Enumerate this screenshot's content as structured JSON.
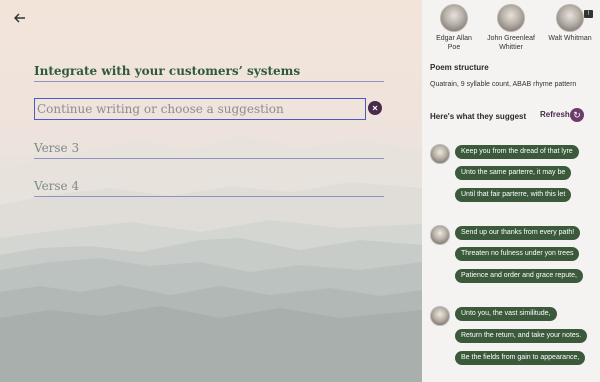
{
  "editor": {
    "verse_1": "Integrate with your customers’ systems",
    "verse_2_placeholder": "Continue writing or choose a suggestion",
    "verse_3": "Verse 3",
    "verse_4": "Verse 4",
    "back_icon": "arrow-left-icon",
    "clear_icon": "close-circle-icon"
  },
  "poets": [
    {
      "name_line1": "Edgar Allan",
      "name_line2": "Poe"
    },
    {
      "name_line1": "John Greenleaf",
      "name_line2": "Whittier"
    },
    {
      "name_line1": "Walt Whitman",
      "name_line2": ""
    }
  ],
  "structure": {
    "title": "Poem structure",
    "description": "Quatrain, 9 syllable count, ABAB rhyme pattern"
  },
  "suggestions": {
    "title": "Here's what they suggest",
    "refresh_label": "Refresh",
    "groups": [
      {
        "lines": [
          "Keep you from the dread of that lyre",
          "Unto the same parterre, it may be",
          "Until that fair parterre, with this let"
        ]
      },
      {
        "lines": [
          "Send up our thanks from every path!",
          "Threaten no fulness under yon trees",
          "Patience and order and grace repute,"
        ]
      },
      {
        "lines": [
          "Unto you, the vast similitude,",
          "Return the return, and take your notes.",
          "Be the fields from gain to appearance,"
        ]
      }
    ]
  },
  "colors": {
    "chip": "#3b5a3b",
    "accent": "#6a3d6a",
    "input_border": "#4a5bc1"
  }
}
